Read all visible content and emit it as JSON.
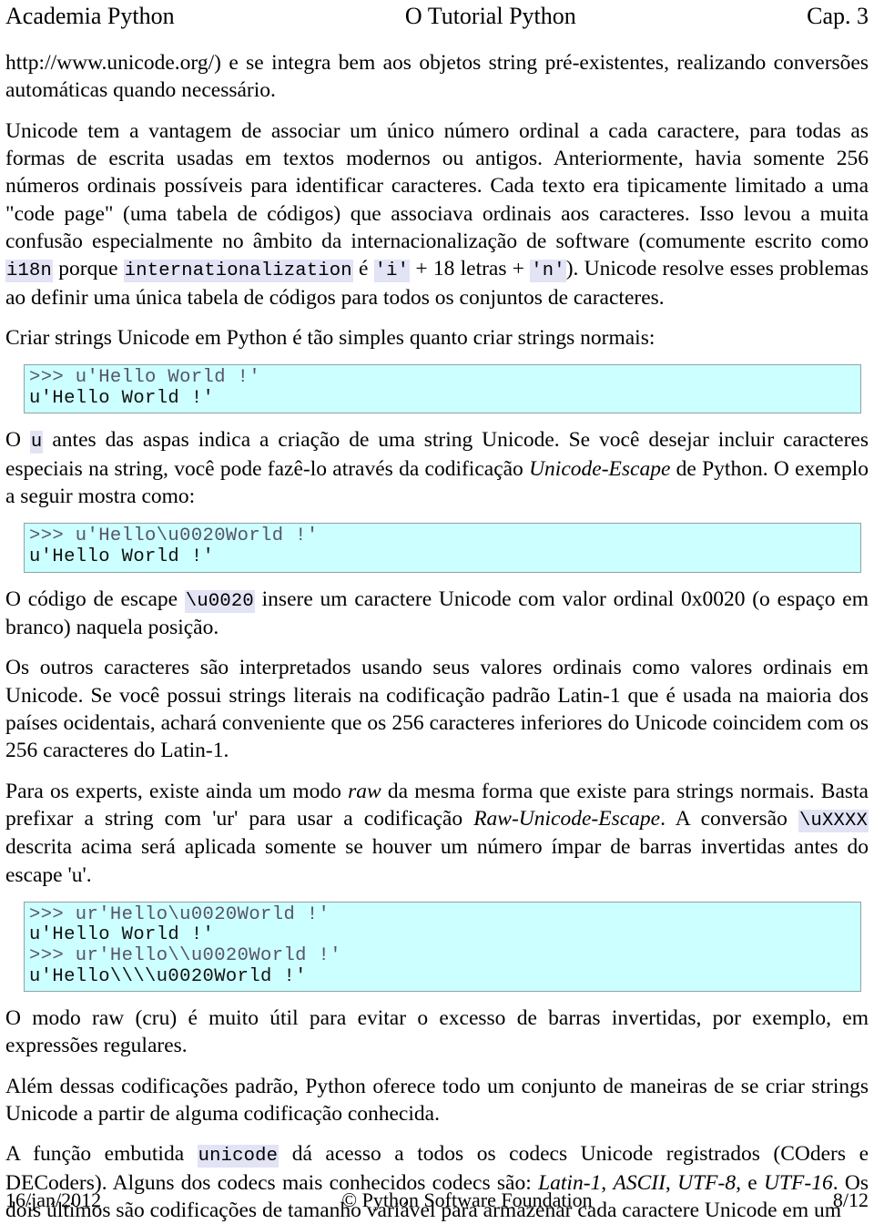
{
  "header": {
    "left": "Academia Python",
    "center": "O Tutorial Python",
    "right": "Cap. 3"
  },
  "footer": {
    "left": "16/jan/2012",
    "center": "© Python Software Foundation",
    "right": "8/12"
  },
  "colors": {
    "code_block_bg": "#ccffff",
    "code_block_border": "#8fa3a3",
    "inline_code_bg": "#e3e3f6",
    "text": "#000000"
  },
  "content": {
    "p1": {
      "text": "http://www.unicode.org/) e se integra bem aos objetos string pré-existentes, realizando conversões automáticas quando necessário."
    },
    "p2": {
      "text": "Unicode tem a vantagem de associar um único número ordinal a cada caractere, para todas as formas de escrita usadas em textos modernos ou antigos. Anteriormente, havia somente 256 números ordinais possíveis para identificar caracteres. Cada texto era tipicamente limitado a uma \"code page\" (uma tabela de códigos) que associava ordinais aos caracteres. Isso levou a muita confusão especialmente no âmbito da internacionalização de software (comumente escrito como ",
      "code_i18n": "i18n",
      "mid1": " porque ",
      "code_intl": "internationalization",
      "mid2": " é ",
      "code_i": "'i'",
      "mid3": " + 18 letras + ",
      "code_n": "'n'",
      "tail": "). Unicode resolve esses problemas ao definir uma única tabela de códigos para todos os conjuntos de caracteres."
    },
    "p3": {
      "text": "Criar strings Unicode em Python é tão simples quanto criar strings normais:"
    },
    "code1": {
      "lines": [
        {
          "kind": "prompt",
          "text": ">>> u'Hello World !'"
        },
        {
          "kind": "out",
          "text": "u'Hello World !'"
        }
      ]
    },
    "p4": {
      "lead": "O ",
      "code_u": "u",
      "mid": " antes das aspas indica a criação de uma string Unicode. Se você desejar incluir caracteres especiais na string, você pode fazê-lo através da codificação ",
      "em_unicode_escape": "Unicode-Escape",
      "tail": " de Python. O exemplo a seguir mostra como:"
    },
    "code2": {
      "lines": [
        {
          "kind": "prompt",
          "text": ">>> u'Hello\\u0020World !'"
        },
        {
          "kind": "out",
          "text": "u'Hello World !'"
        }
      ]
    },
    "p5": {
      "lead": "O código de escape ",
      "code_esc": "\\u0020",
      "tail": " insere um caractere Unicode com valor ordinal 0x0020 (o espaço em branco) naquela posição."
    },
    "p6": {
      "text": "Os outros caracteres são interpretados usando seus valores ordinais como valores ordinais em Unicode. Se você possui strings literais na codificação padrão Latin-1 que é usada na maioria dos países ocidentais, achará conveniente que os 256 caracteres inferiores do Unicode coincidem com os 256 caracteres do Latin-1."
    },
    "p7": {
      "lead": "Para os experts, existe ainda um modo ",
      "em_raw": "raw",
      "mid1": " da mesma forma que existe para strings normais. Basta prefixar a string com 'ur' para usar a codificação ",
      "em_rawesc": "Raw-Unicode-Escape",
      "mid2": ". A conversão ",
      "code_uxxxx": "\\uXXXX",
      "tail": " descrita acima será aplicada somente se houver um número ímpar de barras invertidas antes do escape 'u'."
    },
    "code3": {
      "lines": [
        {
          "kind": "prompt",
          "text": ">>> ur'Hello\\u0020World !'"
        },
        {
          "kind": "out",
          "text": "u'Hello World !'"
        },
        {
          "kind": "prompt",
          "text": ">>> ur'Hello\\\\u0020World !'"
        },
        {
          "kind": "out",
          "text": "u'Hello\\\\\\\\u0020World !'"
        }
      ]
    },
    "p8": {
      "text": "O modo raw (cru) é muito útil para evitar o excesso de barras invertidas, por exemplo, em expressões regulares."
    },
    "p9": {
      "text": "Além dessas codificações padrão, Python oferece todo um conjunto de maneiras de se criar strings Unicode a partir de alguma codificação conhecida."
    },
    "p10": {
      "lead": "A função embutida ",
      "code_unicode": "unicode",
      "mid1": " dá acesso a todos os codecs Unicode registrados (COders e DECoders). Alguns dos codecs mais conhecidos codecs são: ",
      "em_latin1": "Latin-1",
      "sep1": ", ",
      "em_ascii": "ASCII",
      "sep2": ", ",
      "em_utf8": "UTF-8",
      "sep3": ", e ",
      "em_utf16": "UTF-16",
      "tail": ". Os dois últimos são codificações de tamanho variável para armazenar cada caractere Unicode em um"
    }
  }
}
